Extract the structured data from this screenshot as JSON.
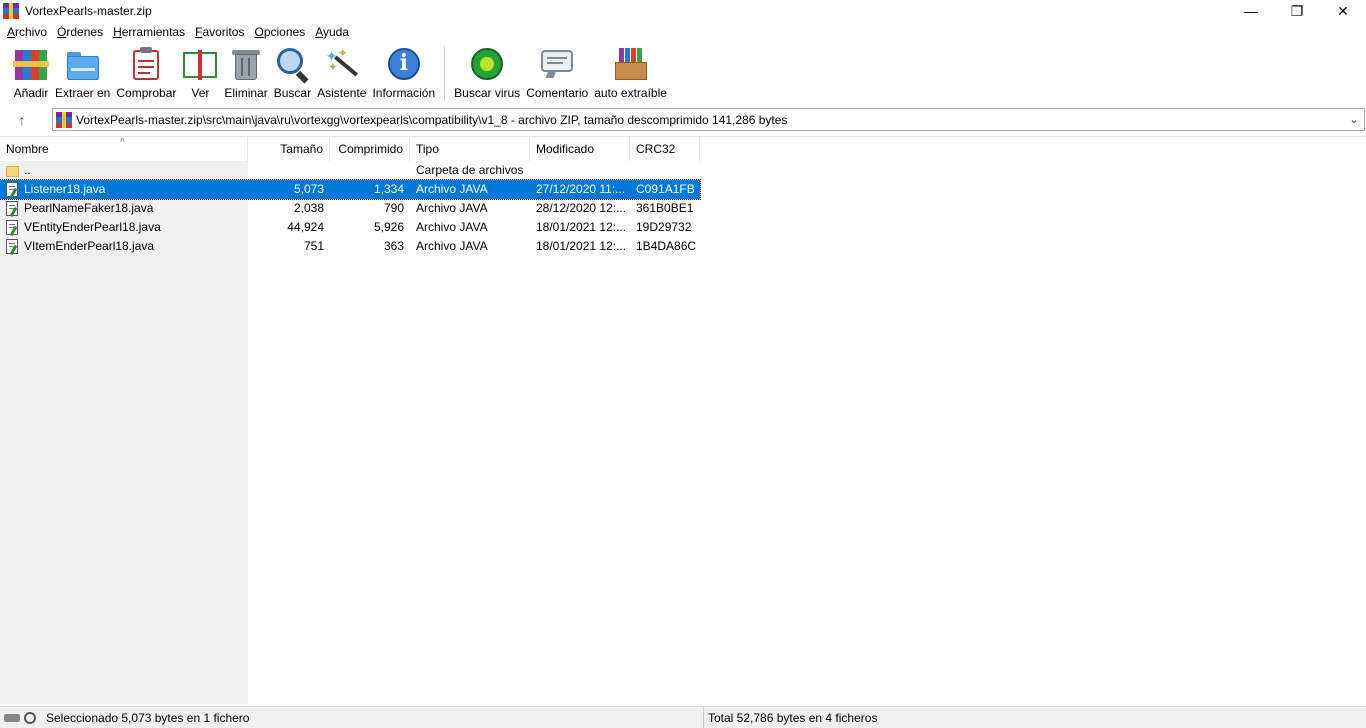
{
  "window": {
    "title": "VortexPearls-master.zip",
    "minimize_glyph": "—",
    "maximize_glyph": "❐",
    "close_glyph": "✕"
  },
  "menu": [
    {
      "accel": "A",
      "rest": "rchivo"
    },
    {
      "accel": "Ó",
      "rest": "rdenes"
    },
    {
      "accel": "H",
      "rest": "erramientas"
    },
    {
      "accel": "F",
      "rest": "avoritos"
    },
    {
      "accel": "O",
      "rest": "pciones"
    },
    {
      "accel": "A",
      "rest": "yuda"
    }
  ],
  "toolbar": {
    "add": "Añadir",
    "extract": "Extraer en",
    "test": "Comprobar",
    "view": "Ver",
    "delete": "Eliminar",
    "find": "Buscar",
    "wizard": "Asistente",
    "info": "Información",
    "virus": "Buscar virus",
    "comment": "Comentario",
    "sfx": "auto extraíble"
  },
  "address": {
    "up_glyph": "↑",
    "path": "VortexPearls-master.zip\\src\\main\\java\\ru\\vortexgg\\vortexpearls\\compatibility\\v1_8 - archivo ZIP, tamaño descomprimido 141,286 bytes",
    "dropdown_glyph": "⌄"
  },
  "columns": {
    "name": "Nombre",
    "size": "Tamaño",
    "compressed": "Comprimido",
    "type": "Tipo",
    "modified": "Modificado",
    "crc": "CRC32",
    "sort_glyph": "^"
  },
  "parent_row": {
    "name": "..",
    "type": "Carpeta de archivos"
  },
  "files": [
    {
      "name": "Listener18.java",
      "size": "5,073",
      "compressed": "1,334",
      "type": "Archivo JAVA",
      "modified": "27/12/2020 11:...",
      "crc": "C091A1FB",
      "selected": true
    },
    {
      "name": "PearlNameFaker18.java",
      "size": "2,038",
      "compressed": "790",
      "type": "Archivo JAVA",
      "modified": "28/12/2020 12:...",
      "crc": "361B0BE1",
      "selected": false
    },
    {
      "name": "VEntityEnderPearl18.java",
      "size": "44,924",
      "compressed": "5,926",
      "type": "Archivo JAVA",
      "modified": "18/01/2021 12:...",
      "crc": "19D29732",
      "selected": false
    },
    {
      "name": "VItemEnderPearl18.java",
      "size": "751",
      "compressed": "363",
      "type": "Archivo JAVA",
      "modified": "18/01/2021 12:...",
      "crc": "1B4DA86C",
      "selected": false
    }
  ],
  "status": {
    "left": "Seleccionado 5,073 bytes en 1 fichero",
    "right": "Total 52,786 bytes en 4 ficheros"
  }
}
